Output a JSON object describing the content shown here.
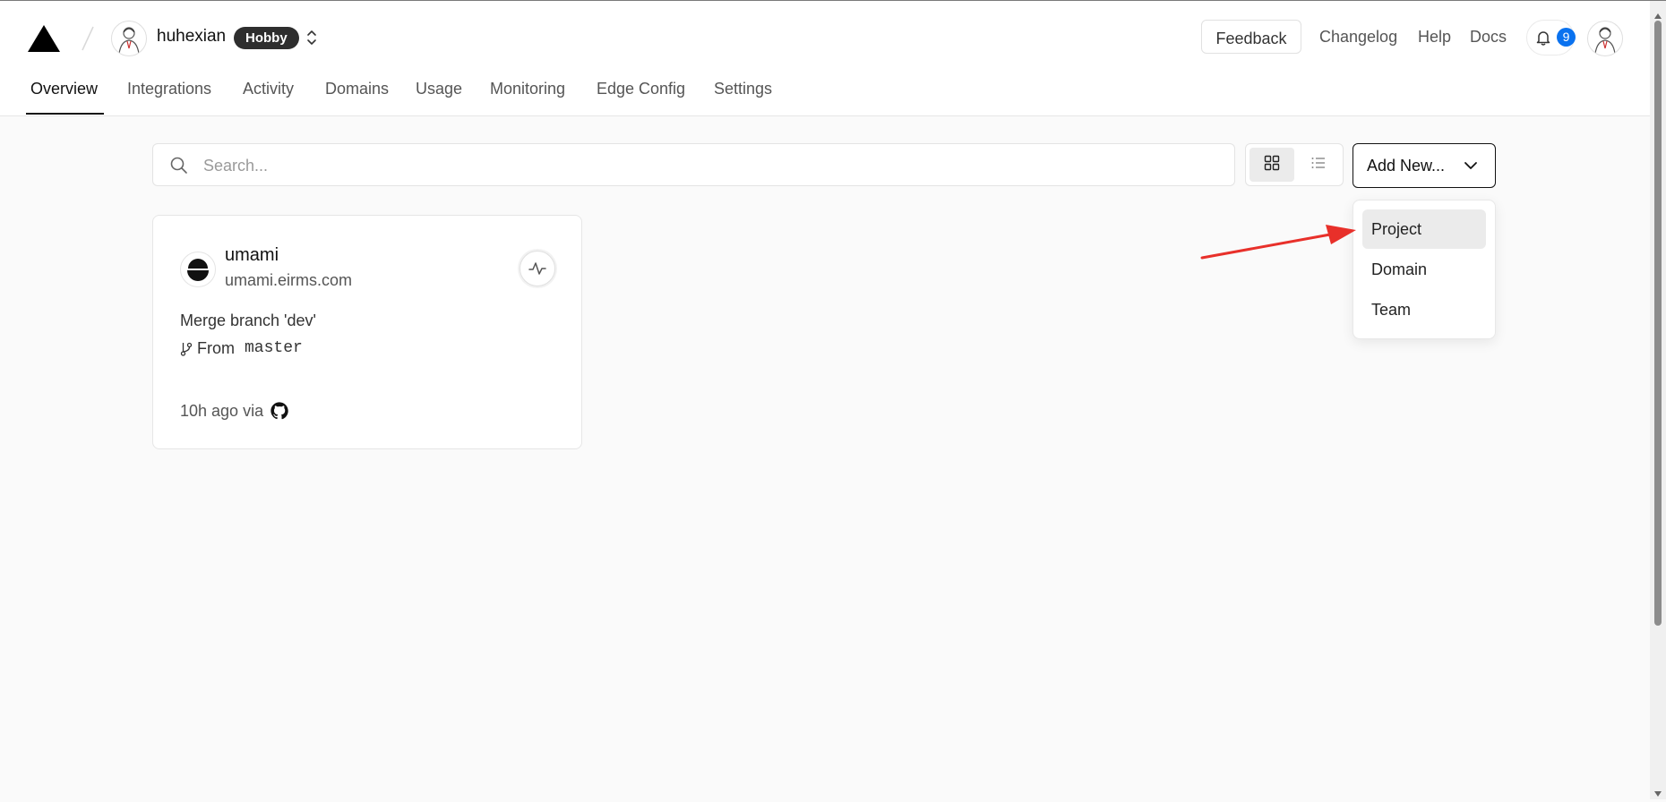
{
  "header": {
    "team_name": "huhexian",
    "plan_badge": "Hobby",
    "feedback_label": "Feedback",
    "links": [
      "Changelog",
      "Help",
      "Docs"
    ],
    "notification_count": "9"
  },
  "tabs": [
    "Overview",
    "Integrations",
    "Activity",
    "Domains",
    "Usage",
    "Monitoring",
    "Edge Config",
    "Settings"
  ],
  "active_tab": "Overview",
  "search": {
    "placeholder": "Search..."
  },
  "view_toggle": {
    "active": "grid"
  },
  "add_new": {
    "label": "Add New...",
    "menu": [
      "Project",
      "Domain",
      "Team"
    ],
    "highlighted": "Project"
  },
  "project": {
    "name": "umami",
    "domain": "umami.eirms.com",
    "commit_message": "Merge branch 'dev'",
    "branch_prefix": "From",
    "branch": "master",
    "time": "10h ago via"
  },
  "colors": {
    "accent_blue": "#0a72ef",
    "annotation_arrow": "#e8302a",
    "badge_dark": "#2e2e2e"
  },
  "icons": [
    "vercel-logo-icon",
    "chevrons-updown-icon",
    "bell-icon",
    "search-icon",
    "grid-view-icon",
    "list-view-icon",
    "chevron-down-icon",
    "activity-pulse-icon",
    "git-branch-icon",
    "github-icon"
  ]
}
